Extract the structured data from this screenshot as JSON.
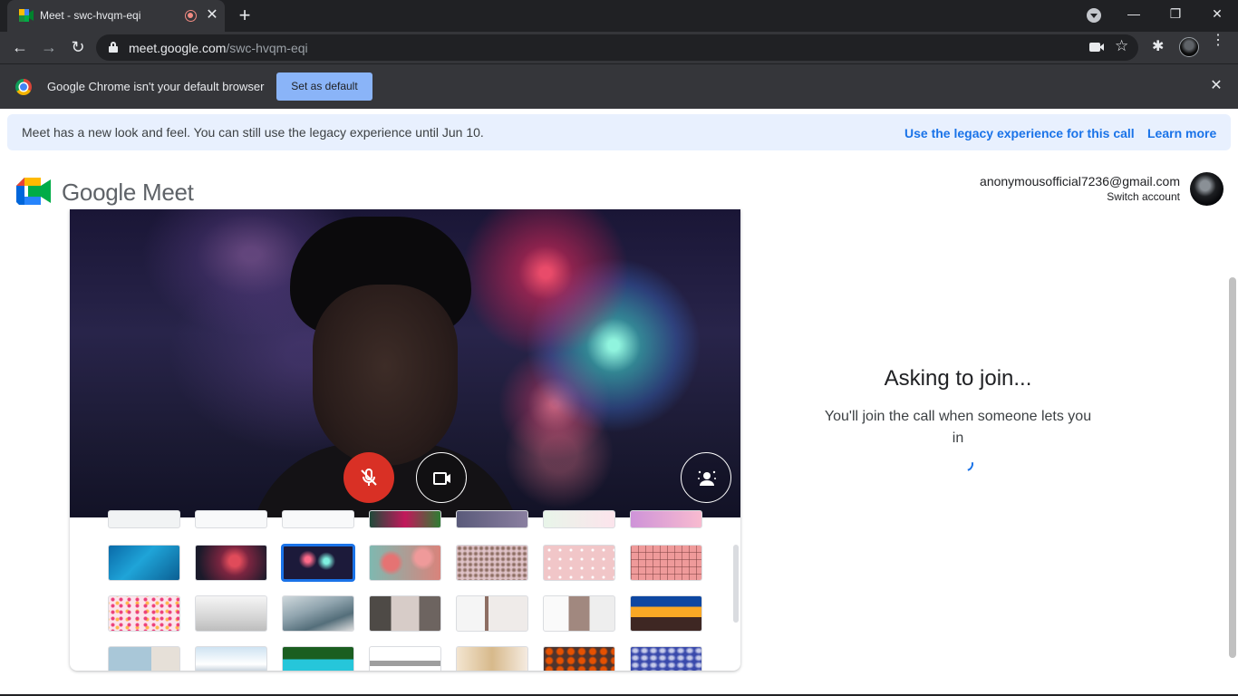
{
  "browser": {
    "tab": {
      "title": "Meet - swc-hvqm-eqi",
      "close_glyph": "✕",
      "recording": true
    },
    "new_tab_glyph": "+",
    "window_controls": {
      "minimize": "—",
      "restore": "❐",
      "close": "✕"
    },
    "nav": {
      "back": "←",
      "forward": "→",
      "reload": "↻"
    },
    "url": {
      "host": "meet.google.com",
      "path": "/swc-hvqm-eqi"
    },
    "icons": [
      "camera-icon",
      "star-icon",
      "extensions-icon",
      "profile-avatar",
      "menu-icon"
    ],
    "star_glyph": "☆",
    "extensions_glyph": "✱",
    "menu_glyph": "⋮"
  },
  "infobar": {
    "message": "Google Chrome isn't your default browser",
    "button_label": "Set as default",
    "close_glyph": "✕"
  },
  "banner": {
    "message": "Meet has a new look and feel. You can still use the legacy experience until Jun 10.",
    "legacy_link": "Use the legacy experience for this call",
    "learn_more": "Learn more"
  },
  "meet": {
    "wordmark": "Google Meet",
    "account_email": "anonymousofficial7236@gmail.com",
    "switch_account": "Switch account"
  },
  "preview": {
    "controls": [
      {
        "name": "microphone-toggle",
        "state": "off"
      },
      {
        "name": "camera-toggle",
        "state": "on"
      },
      {
        "name": "visual-effects",
        "state": "open"
      }
    ],
    "selected_background": "fireworks",
    "background_rows": [
      [
        "partial-1",
        "partial-2",
        "partial-3",
        "partial-4",
        "partial-5",
        "partial-6",
        "partial-7"
      ],
      [
        "underwater",
        "nebula",
        "fireworks",
        "blossoms",
        "flower-field",
        "pink-confetti-wall",
        "pink-tiles"
      ],
      [
        "party-confetti",
        "white-office",
        "glass-atrium",
        "modern-room",
        "bookshelf-loft",
        "shelving",
        "night-cafe"
      ],
      [
        "beach-arch",
        "snowy-mountains",
        "tropical-beach",
        "horse-sketch",
        "wood-interior",
        "autumn-leaves",
        "blue-fern"
      ]
    ]
  },
  "status": {
    "title": "Asking to join...",
    "subtitle": "You'll join the call when someone lets you in"
  },
  "colors": {
    "chrome_dark": "#202124",
    "chrome_toolbar": "#35363a",
    "accent_blue": "#1a73e8",
    "banner_bg": "#e8f0fe",
    "mic_off_red": "#d93025",
    "set_default_blue": "#8ab4f8"
  }
}
